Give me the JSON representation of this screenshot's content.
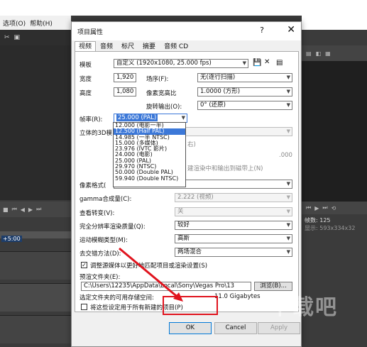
{
  "app": {
    "menu": [
      "选项(O)",
      "帮助(H)"
    ],
    "time_display": "+5:00",
    "info_frames_label": "帧数:",
    "info_frames_value": "125",
    "info_display_label": "显示:",
    "info_display_value": "593x334x32"
  },
  "dialog": {
    "title": "项目属性",
    "help": "?",
    "close": "✕",
    "tabs": [
      "视频",
      "音频",
      "标尺",
      "摘要",
      "音频 CD"
    ],
    "template_label": "模板",
    "template_value": "自定义 (1920x1080, 25.000 fps)",
    "width_label": "宽度",
    "width_value": "1,920",
    "height_label": "高度",
    "height_value": "1,080",
    "field_order_label": "场序(F):",
    "field_order_value": "无(逐行扫描)",
    "pixel_aspect_label": "像素宽高比",
    "pixel_aspect_value": "1.0000 (方形)",
    "rotation_label": "旋转输出(O):",
    "rotation_value": "0° (还原)",
    "frame_rate_label": "帧率(R):",
    "frame_rate_value": "25.000 (PAL)",
    "stereo_label": "立体的3D模",
    "stereo_partial_1": "右)",
    "stereo_partial_2": ".000",
    "stereo_partial_3": "建渲染中和输出到磁带上(N)",
    "pixel_format_label": "像素格式(",
    "gamma_label": "gamma合成量(C):",
    "gamma_value": "2.222 (视频)",
    "view_transform_label": "查看转变(V):",
    "view_transform_value": "关",
    "render_quality_label": "完全分辨率渲染质量(Q):",
    "render_quality_value": "较好",
    "motion_blur_label": "运动模糊类型(M):",
    "motion_blur_value": "高斯",
    "deinterlace_label": "去交错方法(D):",
    "deinterlace_value": "两场混合",
    "adjust_source_label": "调整源媒体以更好地匹配项目或渲染设置(S)",
    "adjust_source_checked": "✓",
    "prerender_label": "预渲文件夹(E):",
    "prerender_path": "C:\\Users\\12235\\AppData\\Local\\Sony\\Vegas Pro\\13",
    "browse_label": "浏览(B)...",
    "free_space_label": "选定文件夹的可用存储空间:",
    "free_space_value": "11.0 Gigabytes",
    "apply_all_label": "将这些设定用于所有新建的项目(P)",
    "frame_rate_options": [
      "12.000 (电影一半)",
      "12.500 (Half PAL)",
      "14.985 (一半 NTSC)",
      "15.000 (多媒体)",
      "23.976 (IVTC 影片)",
      "24.000 (电影)",
      "25.000 (PAL)",
      "29.970 (NTSC)",
      "50.000 (Double PAL)",
      "59.940 (Double NTSC)"
    ],
    "ok_label": "OK",
    "cancel_label": "Cancel",
    "apply_label": "Apply"
  },
  "watermark": "下载吧",
  "colors": {
    "highlight": "#e0141e",
    "selection": "#3c78d8"
  }
}
